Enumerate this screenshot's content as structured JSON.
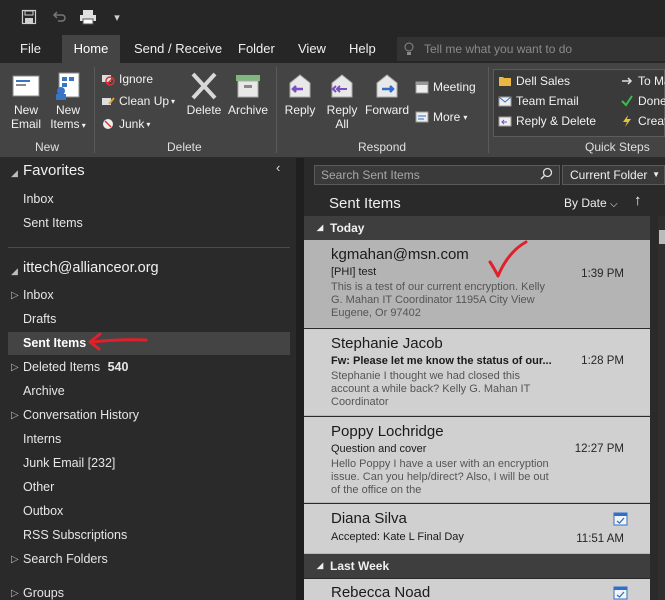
{
  "quick_access": [
    "save-icon",
    "undo-icon",
    "print-icon",
    "customize-icon"
  ],
  "tabs": [
    {
      "label": "File"
    },
    {
      "label": "Home"
    },
    {
      "label": "Send / Receive"
    },
    {
      "label": "Folder"
    },
    {
      "label": "View"
    },
    {
      "label": "Help"
    }
  ],
  "tellme_placeholder": "Tell me what you want to do",
  "ribbon": {
    "new_email": "New\nEmail",
    "new_items": "New\nItems",
    "ignore": "Ignore",
    "clean_up": "Clean Up",
    "junk": "Junk",
    "delete": "Delete",
    "archive": "Archive",
    "reply": "Reply",
    "reply_all": "Reply\nAll",
    "forward": "Forward",
    "meeting": "Meeting",
    "more": "More",
    "qs_dell": "Dell Sales",
    "qs_team": "Team Email",
    "qs_reply_delete": "Reply & Delete",
    "qs_to_manager": "To Ma",
    "qs_done": "Done",
    "qs_create": "Creat",
    "groups": {
      "new": "New",
      "delete": "Delete",
      "respond": "Respond",
      "quick_steps": "Quick Steps"
    }
  },
  "folders": {
    "favorites_title": "Favorites",
    "favorites": [
      "Inbox",
      "Sent Items"
    ],
    "account": "ittech@allianceor.org",
    "items": [
      {
        "label": "Inbox",
        "expander": true
      },
      {
        "label": "Drafts"
      },
      {
        "label": "Sent Items",
        "selected": true
      },
      {
        "label": "Deleted Items",
        "expander": true,
        "count": "540"
      },
      {
        "label": "Archive"
      },
      {
        "label": "Conversation History",
        "expander": true
      },
      {
        "label": "Interns"
      },
      {
        "label": "Junk Email [232]"
      },
      {
        "label": "Other"
      },
      {
        "label": "Outbox"
      },
      {
        "label": "RSS Subscriptions"
      },
      {
        "label": "Search Folders",
        "expander": true
      }
    ],
    "groups": "Groups"
  },
  "list": {
    "search_placeholder": "Search Sent Items",
    "scope": "Current Folder",
    "title": "Sent Items",
    "sort": "By Date",
    "groups": [
      {
        "label": "Today"
      },
      {
        "label": "Last Week"
      }
    ],
    "messages": [
      {
        "from": "kgmahan@msn.com",
        "subject": "[PHI] test",
        "time": "1:39 PM",
        "preview": "This is a test of our current encryption. Kelly G. Mahan  IT Coordinator 1195A City View  Eugene, Or 97402"
      },
      {
        "from": "Stephanie Jacob",
        "subject": "Fw: Please let me know the status of our...",
        "time": "1:28 PM",
        "preview": "Stephanie  I thought we had closed this account a while back?  Kelly G. Mahan  IT Coordinator"
      },
      {
        "from": "Poppy Lochridge",
        "subject": "Question and cover",
        "time": "12:27 PM",
        "preview": "Hello Poppy  I have a user with an encryption issue.  Can you help/direct? Also,  I will be out of the office on the"
      },
      {
        "from": "Diana Silva",
        "subject": "Accepted: Kate L Final Day",
        "time": "11:51 AM",
        "preview": ""
      },
      {
        "from": "Rebecca Noad",
        "subject": "",
        "time": "",
        "preview": ""
      }
    ]
  },
  "annotation_color": "#e0202a"
}
